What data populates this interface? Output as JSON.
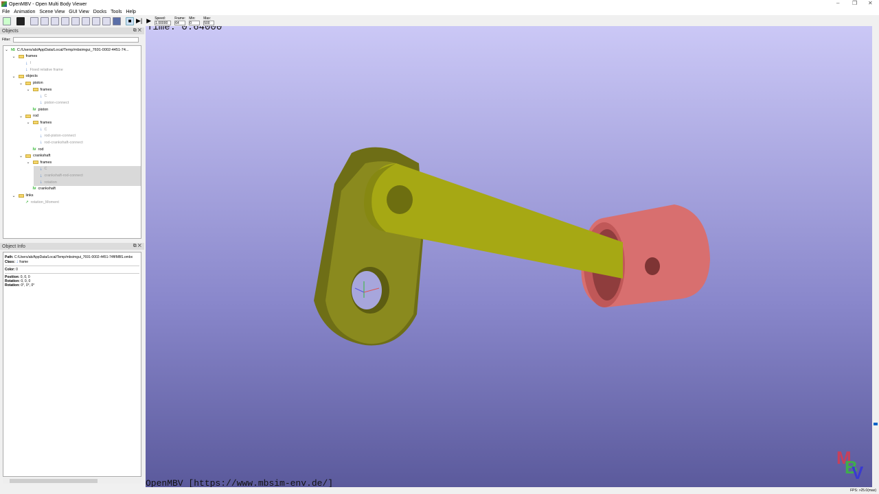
{
  "window": {
    "title": "OpenMBV - Open Multi Body Viewer"
  },
  "menu": [
    "File",
    "Animation",
    "Scene View",
    "GUI View",
    "Docks",
    "Tools",
    "Help"
  ],
  "toolbar": {
    "speed_label": "Speed:",
    "speed_value": "1.00000",
    "frame_label": "Frame:",
    "frame_value": "64",
    "min_label": "Min:",
    "min_value": "0",
    "max_label": "Max:",
    "max_value": "500"
  },
  "objects_dock": {
    "title": "Objects",
    "filter_label": "Filter:",
    "filter_value": ""
  },
  "tree": [
    {
      "label": "C:/Users/ab/AppData/Local/Temp/mbsimgui_7691-0002-4451-74...",
      "icon": "xml-h5-icon",
      "depth": 0,
      "chev": true
    },
    {
      "label": "frames",
      "icon": "folder-icon",
      "depth": 1,
      "chev": true
    },
    {
      "label": "I",
      "icon": "frame-icon",
      "depth": 2,
      "gray": true
    },
    {
      "label": "Fixed relative frame",
      "icon": "frame-icon",
      "depth": 2,
      "gray": true
    },
    {
      "label": "objects",
      "icon": "folder-icon",
      "depth": 1,
      "chev": true
    },
    {
      "label": "piston",
      "icon": "folder-icon",
      "depth": 2,
      "chev": true
    },
    {
      "label": "frames",
      "icon": "folder-icon",
      "depth": 3,
      "chev": true
    },
    {
      "label": "C",
      "icon": "frame-icon",
      "depth": 4,
      "gray": true
    },
    {
      "label": "piston-connect",
      "icon": "frame-icon",
      "depth": 4,
      "gray": true
    },
    {
      "label": "piston",
      "icon": "iv-icon",
      "depth": 3
    },
    {
      "label": "rod",
      "icon": "folder-icon",
      "depth": 2,
      "chev": true
    },
    {
      "label": "frames",
      "icon": "folder-icon",
      "depth": 3,
      "chev": true
    },
    {
      "label": "C",
      "icon": "frame-icon",
      "depth": 4,
      "gray": true
    },
    {
      "label": "rod-piston-connect",
      "icon": "frame-icon",
      "depth": 4,
      "gray": true
    },
    {
      "label": "rod-crankshaft-connect",
      "icon": "frame-icon",
      "depth": 4,
      "gray": true
    },
    {
      "label": "rod",
      "icon": "iv-icon",
      "depth": 3
    },
    {
      "label": "crankshaft",
      "icon": "folder-icon",
      "depth": 2,
      "chev": true
    },
    {
      "label": "frames",
      "icon": "folder-icon",
      "depth": 3,
      "chev": true
    },
    {
      "label": "C",
      "icon": "frame-icon",
      "depth": 4,
      "gray": true,
      "sel": true
    },
    {
      "label": "crankshaft-rod-connect",
      "icon": "frame-icon",
      "depth": 4,
      "gray": true,
      "sel": true
    },
    {
      "label": "rotation",
      "icon": "frame-icon",
      "depth": 4,
      "gray": true,
      "sel": true
    },
    {
      "label": "crankshaft",
      "icon": "iv-icon",
      "depth": 3
    },
    {
      "label": "links",
      "icon": "folder-icon",
      "depth": 1,
      "chev": true
    },
    {
      "label": "rotation_Moment",
      "icon": "arrow-icon",
      "depth": 2,
      "gray": true
    }
  ],
  "info_dock": {
    "title": "Object Info",
    "path_label": "Path:",
    "path": "C:/Users/ab/AppData/Local/Temp/mbsimgui_7691-0002-4451-74ff/MBS.ombx",
    "class_label": "Class:",
    "class": "frame",
    "color_label": "Color:",
    "color": "0",
    "position_label": "Position:",
    "position": "0, 0, 0",
    "rotation_label": "Rotation:",
    "rotation": "0, 0, 0",
    "rotation2_label": "Rotation:",
    "rotation2": "0°, 0°, 0°"
  },
  "viewer": {
    "time_text": "Time: 0.64000",
    "url_text": "OpenMBV [https://www.mbsim-env.de/]",
    "logo": "MBV",
    "bg_top": "#cbc8f6",
    "bg_bottom": "#5b5a9c",
    "crank_color": "#8a8a1e",
    "rod_color": "#a6a814",
    "piston_color": "#d86f6f"
  },
  "status": {
    "fps": "FPS: >25.0(max)"
  }
}
